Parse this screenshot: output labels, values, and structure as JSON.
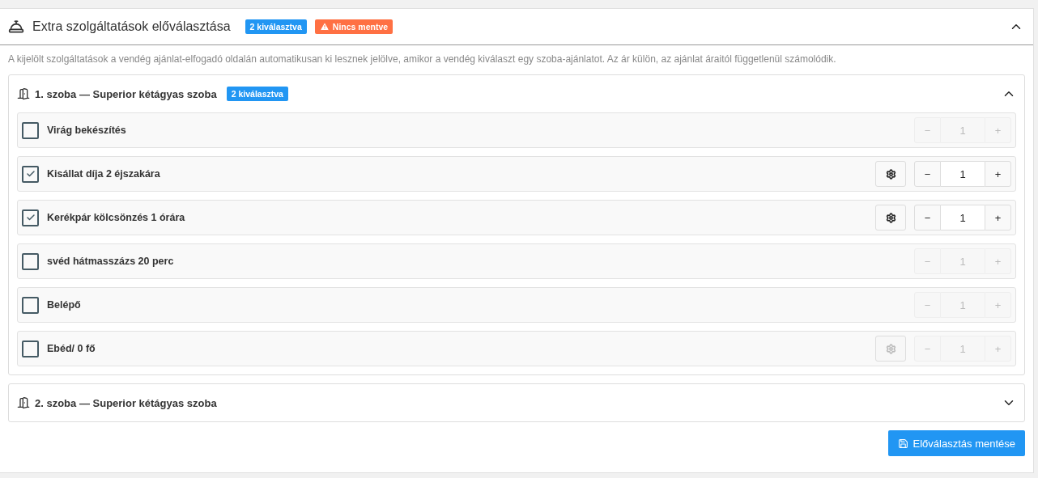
{
  "panel": {
    "title": "Extra szolgáltatások előválasztása",
    "badges": [
      {
        "kind": "info",
        "text": "2 kiválasztva"
      },
      {
        "kind": "warning",
        "text": "Nincs mentve"
      }
    ],
    "expanded": true
  },
  "description": "A kijelölt szolgáltatások a vendég ajánlat-elfogadó oldalán automatikusan ki lesznek jelölve, amikor a vendég kiválaszt egy szoba-ajánlatot. Az ár külön, az ajánlat áraitól függetlenül számolódik.",
  "rooms": [
    {
      "title": "1. szoba — Superior kétágyas szoba",
      "badge": "2 kiválasztva",
      "expanded": true,
      "services": [
        {
          "name": "Virág bekészítés",
          "checked": false,
          "settings": false,
          "minus": "−",
          "quantity": "1",
          "plus": "+"
        },
        {
          "name": "Kisállat díja 2 éjszakára",
          "checked": true,
          "settings": true,
          "minus": "−",
          "quantity": "1",
          "plus": "+"
        },
        {
          "name": "Kerékpár kölcsönzés 1 órára",
          "checked": true,
          "settings": true,
          "minus": "−",
          "quantity": "1",
          "plus": "+"
        },
        {
          "name": "svéd hátmasszázs 20 perc",
          "checked": false,
          "settings": false,
          "minus": "−",
          "quantity": "1",
          "plus": "+"
        },
        {
          "name": "Belépő",
          "checked": false,
          "settings": false,
          "minus": "−",
          "quantity": "1",
          "plus": "+"
        },
        {
          "name": "Ebéd/ 0 fő",
          "checked": false,
          "settings": true,
          "minus": "−",
          "quantity": "1",
          "plus": "+"
        }
      ]
    },
    {
      "title": "2. szoba — Superior kétágyas szoba",
      "expanded": false
    }
  ],
  "save_button": "Előválasztás mentése"
}
